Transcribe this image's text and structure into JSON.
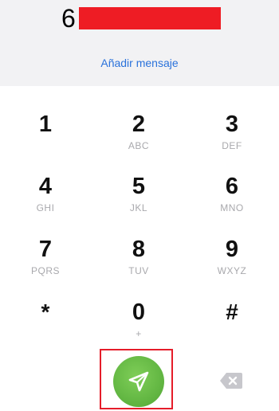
{
  "header": {
    "number_prefix": "6",
    "add_message_label": "Añadir mensaje"
  },
  "keypad": {
    "keys": [
      {
        "digit": "1",
        "letters": ""
      },
      {
        "digit": "2",
        "letters": "ABC"
      },
      {
        "digit": "3",
        "letters": "DEF"
      },
      {
        "digit": "4",
        "letters": "GHI"
      },
      {
        "digit": "5",
        "letters": "JKL"
      },
      {
        "digit": "6",
        "letters": "MNO"
      },
      {
        "digit": "7",
        "letters": "PQRS"
      },
      {
        "digit": "8",
        "letters": "TUV"
      },
      {
        "digit": "9",
        "letters": "WXYZ"
      },
      {
        "digit": "*",
        "letters": ""
      },
      {
        "digit": "0",
        "letters": "+"
      },
      {
        "digit": "#",
        "letters": ""
      }
    ]
  },
  "actions": {
    "send_icon": "paper-plane-icon",
    "backspace_icon": "backspace-icon"
  },
  "colors": {
    "accent_blue": "#2a72db",
    "send_green": "#63b743",
    "highlight_red": "#e51d2a",
    "redaction_red": "#ee1c24"
  }
}
